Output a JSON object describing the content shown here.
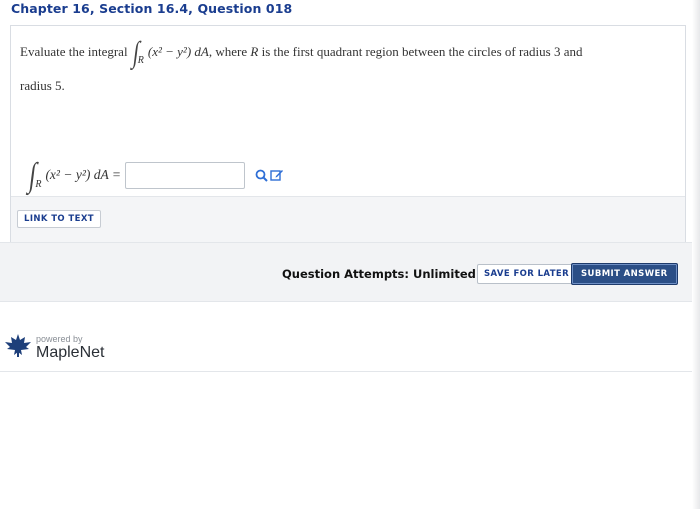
{
  "header": {
    "title": "Chapter 16, Section 16.4, Question 018"
  },
  "question": {
    "prompt_start": "Evaluate the integral",
    "integrand": "(x² − y²) dA",
    "region_sub": "R",
    "prompt_mid": ", where",
    "R": "R",
    "prompt_end": "is the first quadrant region between the circles of radius 3 and",
    "prompt_line2": "radius 5."
  },
  "answer": {
    "lhs": "(x² − y²) dA =",
    "region_sub": "R",
    "input_value": "",
    "input_placeholder": ""
  },
  "links": {
    "link_to_text": "LINK TO TEXT"
  },
  "footer": {
    "attempts": "Question Attempts: Unlimited",
    "save_label": "SAVE FOR LATER",
    "submit_label": "SUBMIT ANSWER"
  },
  "branding": {
    "powered_by": "powered by",
    "brand": "MapleNet"
  },
  "icons": {
    "search": "search-icon",
    "edit": "edit-icon",
    "logo": "maple-leaf-icon"
  },
  "colors": {
    "title_blue": "#1a3d8f",
    "submit_bg": "#2b4e86",
    "icon_blue": "#2f6fd6"
  }
}
